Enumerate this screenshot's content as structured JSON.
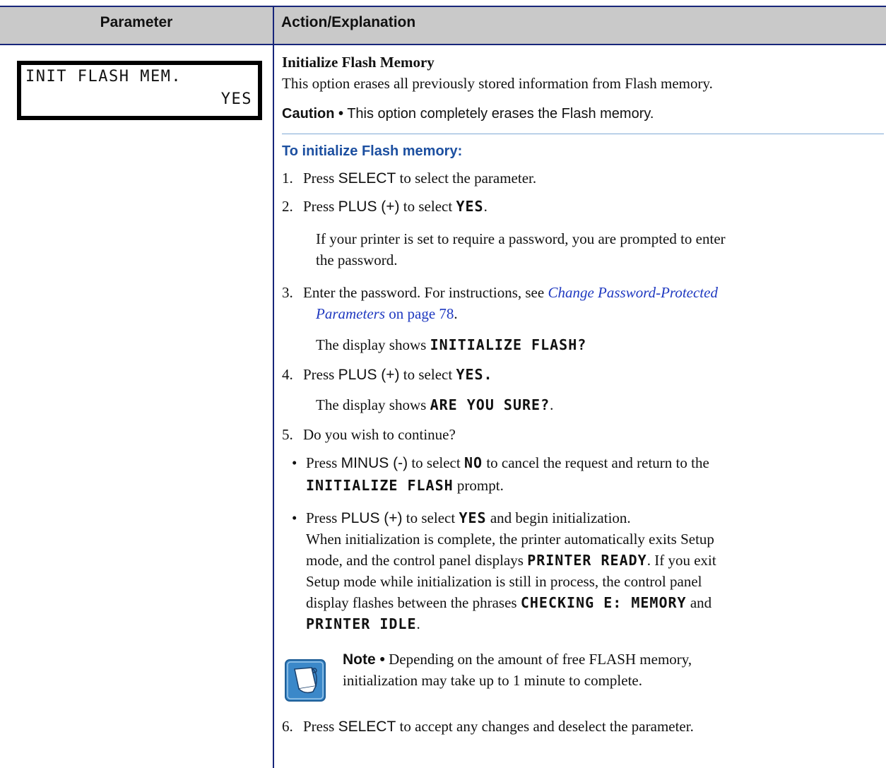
{
  "header": {
    "col1": "Parameter",
    "col2": "Action/Explanation"
  },
  "lcd": {
    "line1": "INIT FLASH MEM.",
    "line2": "YES"
  },
  "section": {
    "title": "Initialize Flash Memory",
    "desc": "This option erases all previously stored information from Flash memory.",
    "caution_label": "Caution •",
    "caution_text": " This option completely erases the Flash memory."
  },
  "procedure": {
    "heading": "To initialize Flash memory:",
    "s1": {
      "n": "1.",
      "a": "Press ",
      "b": "SELECT",
      "c": " to select the parameter."
    },
    "s2": {
      "n": "2.",
      "a": "Press ",
      "b": "PLUS (+)",
      "c": " to select ",
      "d": "YES",
      "e": "."
    },
    "s2_sub1": "If your printer is set to require a password, you are prompted to enter",
    "s2_sub2": "the password.",
    "s3": {
      "n": "3.",
      "a": "Enter the password. For instructions, see ",
      "link1": "Change Password-Protected",
      "link2": "Parameters",
      "b": " on page 78",
      "c": "."
    },
    "s3_sub": {
      "a": "The display shows ",
      "b": "INITIALIZE FLASH?"
    },
    "s4": {
      "n": "4.",
      "a": "Press ",
      "b": "PLUS (+)",
      "c": " to select ",
      "d": "YES."
    },
    "s4_sub": {
      "a": "The display shows ",
      "b": "ARE YOU SURE?",
      "c": "."
    },
    "s5": {
      "n": "5.",
      "a": "Do you wish to continue?"
    },
    "b1": {
      "dot": "•",
      "a": "Press ",
      "b": "MINUS (-)",
      "c": " to select ",
      "d": "NO",
      "e": " to cancel the request and return to the",
      "f": "INITIALIZE FLASH",
      "g": " prompt."
    },
    "b2": {
      "dot": "•",
      "a": "Press ",
      "b": "PLUS (+)",
      "c": " to select ",
      "d": "YES",
      "e": " and begin initialization."
    },
    "b2_l2": "When initialization is complete, the printer automatically exits Setup",
    "b2_l3": {
      "a": "mode, and the control panel displays ",
      "b": "PRINTER READY",
      "c": ". If you exit"
    },
    "b2_l4": "Setup mode while initialization is still in process, the control panel",
    "b2_l5": {
      "a": "display flashes between the phrases ",
      "b": "CHECKING E: MEMORY",
      "c": " and"
    },
    "b2_l6": {
      "a": "PRINTER IDLE",
      "b": "."
    },
    "note": {
      "label": "Note •",
      "text": " Depending on the amount of free FLASH memory,",
      "line2": "initialization may take up to 1 minute to complete."
    },
    "s6": {
      "n": "6.",
      "a": "Press ",
      "b": "SELECT",
      "c": " to accept any changes and deselect the parameter."
    }
  },
  "colors": {
    "rule": "#17257a",
    "header_bg": "#c9c9c9",
    "heading_blue": "#1c4fa0",
    "link": "#1f39c0"
  }
}
